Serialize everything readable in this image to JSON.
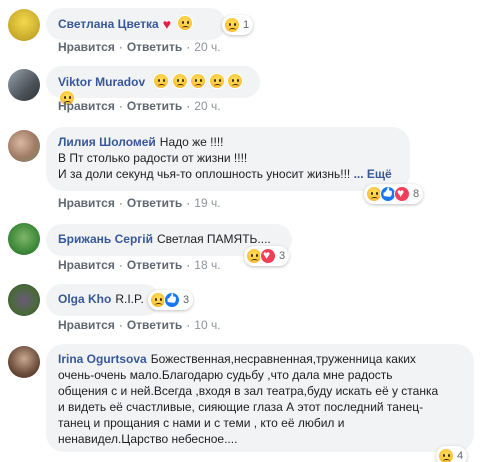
{
  "comments": [
    {
      "author": "Светлана Цветка",
      "text_before": "",
      "lines": [],
      "trail": "♥",
      "react_count": "1",
      "like_label": "Нравится",
      "reply_label": "Ответить",
      "time": "20 ч."
    },
    {
      "author": "Viktor Muradov",
      "lines": [],
      "like_label": "Нравится",
      "reply_label": "Ответить",
      "time": "20 ч."
    },
    {
      "author": "Лилия Шоломей",
      "first_line": "Надо же !!!!",
      "lines": [
        "В Пт столько радости от жизни !!!!",
        "И за доли секунд чья-то оплошность уносит жизнь!!!"
      ],
      "more": "... Ещё",
      "react_count": "8",
      "like_label": "Нравится",
      "reply_label": "Ответить",
      "time": "19 ч."
    },
    {
      "author": "Брижань Сергій",
      "first_line": "Светлая ПАМЯТЬ....",
      "react_count": "3",
      "like_label": "Нравится",
      "reply_label": "Ответить",
      "time": "18 ч."
    },
    {
      "author": "Olga Kho",
      "first_line": "R.I.P.",
      "react_count": "3",
      "like_label": "Нравится",
      "reply_label": "Ответить",
      "time": "10 ч."
    },
    {
      "author": "Irina Ogurtsova",
      "first_line": "Божественная,несравненная,труженница каких",
      "lines": [
        "очень-очень мало.Благодарю судьбу ,что дала мне радость",
        "общения с и ней.Всегда ,входя в зал театра,буду искать её у станка",
        "и видеть её счастливые, сияющие глаза А этот последний танец-",
        "танец и прощания с нами и с теми , кто её любил и",
        "ненавидел.Царство небесное...."
      ],
      "react_count": "4"
    }
  ],
  "colors": {
    "link": "#385898",
    "bubble": "#f2f3f5",
    "meta": "#606770"
  }
}
